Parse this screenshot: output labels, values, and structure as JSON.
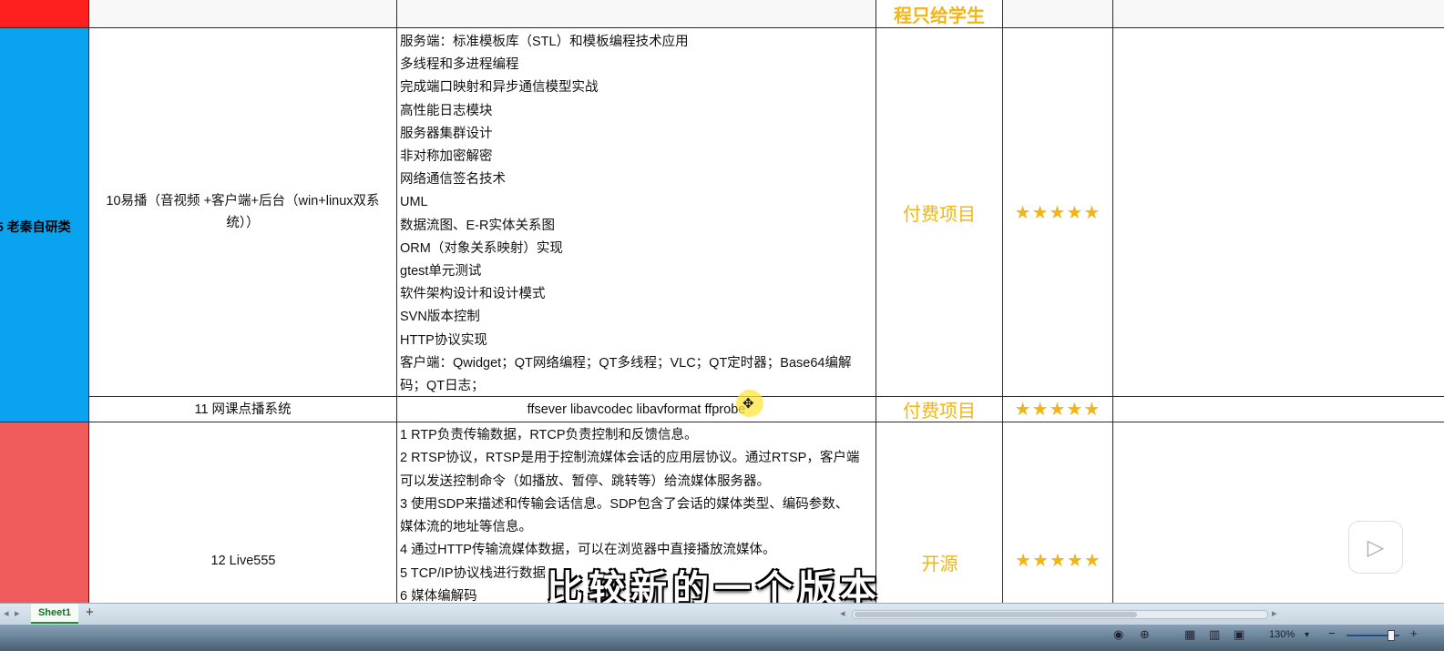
{
  "rows": {
    "top": {
      "type": "程只给学生"
    },
    "project10": {
      "category": "5 老秦自研类",
      "name": "10易播（音视频 +客户端+后台（win+linux双系统））",
      "details": [
        "服务端：标准模板库（STL）和模板编程技术应用",
        "多线程和多进程编程",
        "完成端口映射和异步通信模型实战",
        "高性能日志模块",
        "服务器集群设计",
        "非对称加密解密",
        "网络通信签名技术",
        "UML",
        "数据流图、E-R实体关系图",
        "ORM（对象关系映射）实现",
        "gtest单元测试",
        "软件架构设计和设计模式",
        "SVN版本控制",
        "HTTP协议实现",
        "客户端：Qwidget；QT网络编程；QT多线程；VLC；QT定时器；Base64编解",
        "码；QT日志；"
      ],
      "type": "付费项目",
      "stars": "★★★★★"
    },
    "project11": {
      "name": "11 网课点播系统",
      "details": "ffsever libavcodec libavformat ffprobe",
      "type": "付费项目",
      "stars": "★★★★★"
    },
    "project12": {
      "name": "12 Live555",
      "details": [
        "1 RTP负责传输数据，RTCP负责控制和反馈信息。",
        "2 RTSP协议，RTSP是用于控制流媒体会话的应用层协议。通过RTSP，客户端",
        "可以发送控制命令（如播放、暂停、跳转等）给流媒体服务器。",
        "3 使用SDP来描述和传输会话信息。SDP包含了会话的媒体类型、编码参数、",
        "媒体流的地址等信息。",
        "4 通过HTTP传输流媒体数据，可以在浏览器中直接播放流媒体。",
        "5 TCP/IP协议栈进行数据",
        "6 媒体编解码"
      ],
      "type": "开源",
      "stars": "★★★★★"
    }
  },
  "subtitle": "比较新的一个版本",
  "sheet_tabs": {
    "active": "Sheet1",
    "add": "+"
  },
  "status": {
    "zoom": "130%"
  },
  "colors": {
    "category_red": "#ff1f1f",
    "category_blue": "#0aa3ef",
    "category_salmon": "#ef5a5a",
    "accent_gold": "#f2b518"
  },
  "icons": [
    "play-icon",
    "cursor-move-icon",
    "eye-icon",
    "page-normal-icon",
    "page-layout-icon",
    "page-break-icon"
  ]
}
